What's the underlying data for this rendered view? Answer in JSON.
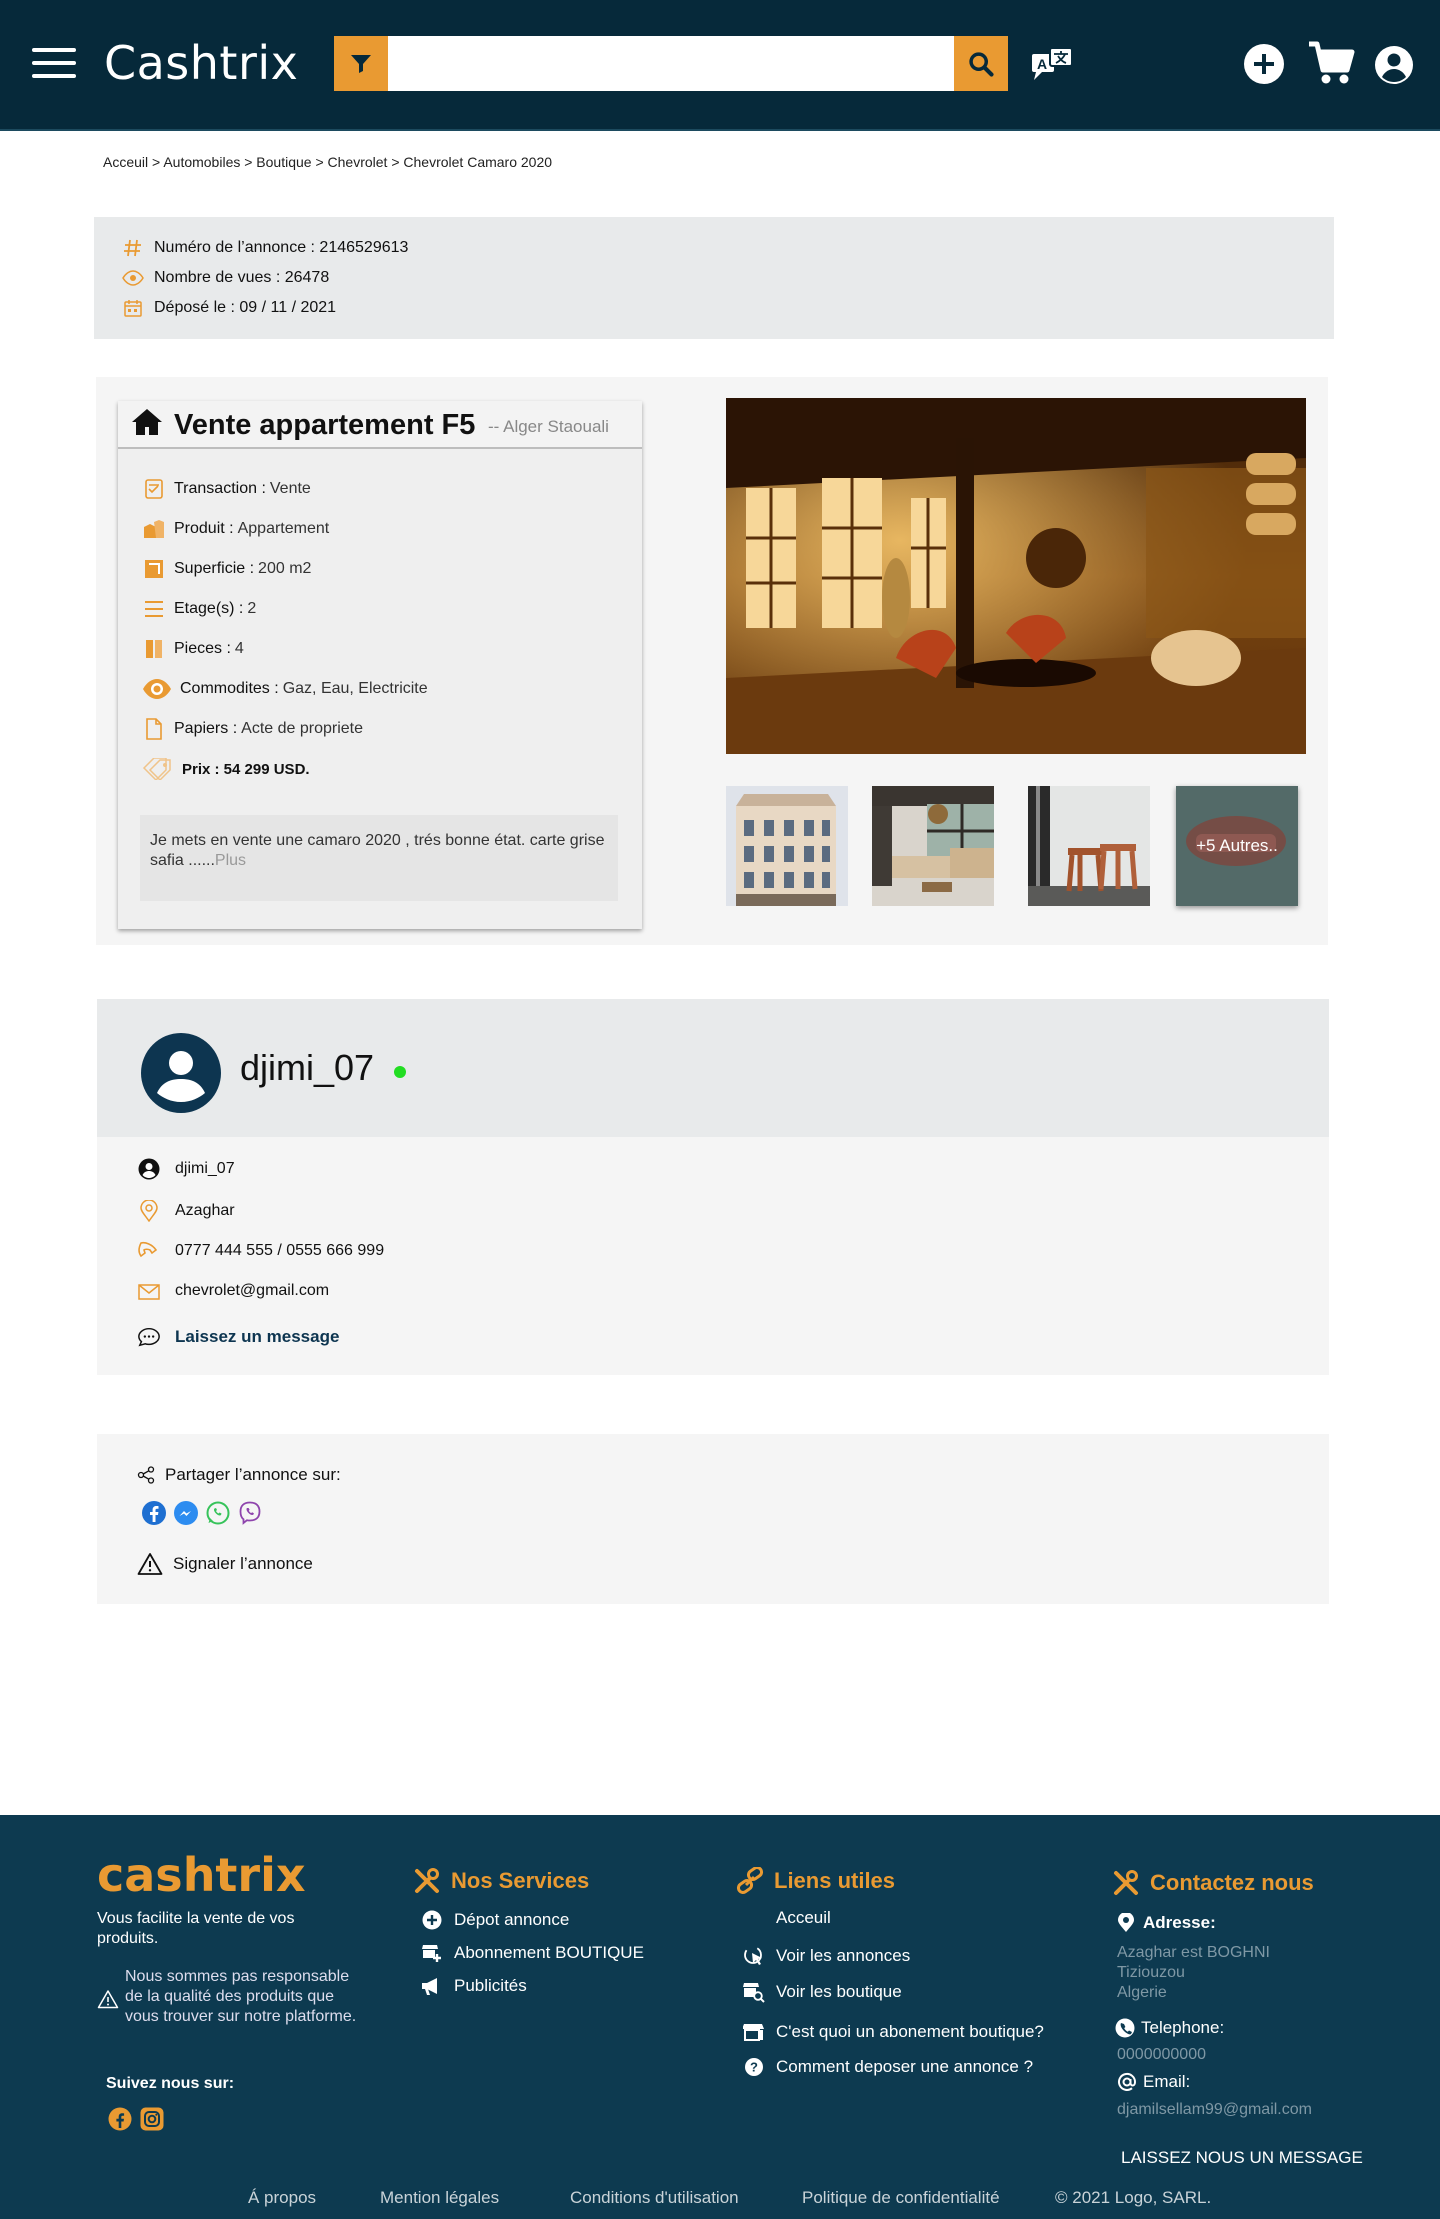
{
  "header": {
    "brand": "Cashtrix",
    "search_value": "",
    "search_placeholder": ""
  },
  "breadcrumb": "Acceuil > Automobiles > Boutique > Chevrolet > Chevrolet Camaro 2020",
  "info": {
    "number": "Numéro de l’annonce : 2146529613",
    "views": "Nombre de vues : 26478",
    "posted": "Déposé le : 09 / 11 / 2021"
  },
  "listing": {
    "title": "Vente appartement F5",
    "location": "-- Alger Staouali",
    "attributes": [
      {
        "label": "Transaction :",
        "value": "Vente",
        "icon": "form-icon"
      },
      {
        "label": "Produit :",
        "value": "Appartement",
        "icon": "box-icon"
      },
      {
        "label": "Superficie :",
        "value": "200 m2",
        "icon": "area-icon"
      },
      {
        "label": "Etage(s) :",
        "value": "2",
        "icon": "floors-icon"
      },
      {
        "label": "Pieces :",
        "value": "4",
        "icon": "rooms-icon"
      },
      {
        "label": "Commodites :",
        "value": "Gaz, Eau, Electricite",
        "icon": "eye-icon"
      },
      {
        "label": "Papiers :",
        "value": "Acte de propriete",
        "icon": "document-icon"
      }
    ],
    "price": "Prix : 54 299 USD.",
    "description": "Je mets en vente une camaro 2020 , trés bonne état. carte grise safia ......",
    "description_more": "Plus",
    "more_photos": "+5 Autres.."
  },
  "seller": {
    "name": "djimi_07",
    "username": "djimi_07",
    "city": "Azaghar",
    "phone": "0777 444 555 / 0555 666 999",
    "email": "chevrolet@gmail.com",
    "message": "Laissez un message"
  },
  "share": {
    "label": "Partager l’annonce sur:",
    "report": "Signaler l’annonce"
  },
  "footer": {
    "brand": "cashtrix",
    "tagline": "Vous facilite la vente de vos produits.",
    "disclaimer": "Nous sommes pas responsable de la qualité des produits que vous trouver sur notre platforme.",
    "follow": "Suivez nous sur:",
    "services": {
      "title": "Nos Services",
      "items": [
        "Dépot annonce",
        "Abonnement BOUTIQUE",
        "Publicités"
      ]
    },
    "links": {
      "title": "Liens utiles",
      "items": [
        "Acceuil",
        "Voir les annonces",
        "Voir les boutique",
        "C'est quoi un abonement boutique?",
        "Comment deposer une annonce ?"
      ]
    },
    "contact": {
      "title": "Contactez nous",
      "address_label": "Adresse:",
      "address_lines": [
        "Azaghar est BOGHNI",
        "Tiziouzou",
        "Algerie"
      ],
      "phone_label": "Telephone:",
      "phone": "0000000000",
      "email_label": "Email:",
      "email": "djamilsellam99@gmail.com",
      "cta": "LAISSEZ NOUS UN MESSAGE"
    },
    "bottom": [
      "Á propos",
      "Mention légales",
      "Conditions d'utilisation",
      "Politique de confidentialité",
      "© 2021 Logo, SARL."
    ]
  },
  "colors": {
    "header_bg": "#06293a",
    "accent": "#e99a32",
    "footer_bg": "#0d3a50",
    "online": "#22dd22",
    "panel_bg": "#f5f5f5"
  }
}
